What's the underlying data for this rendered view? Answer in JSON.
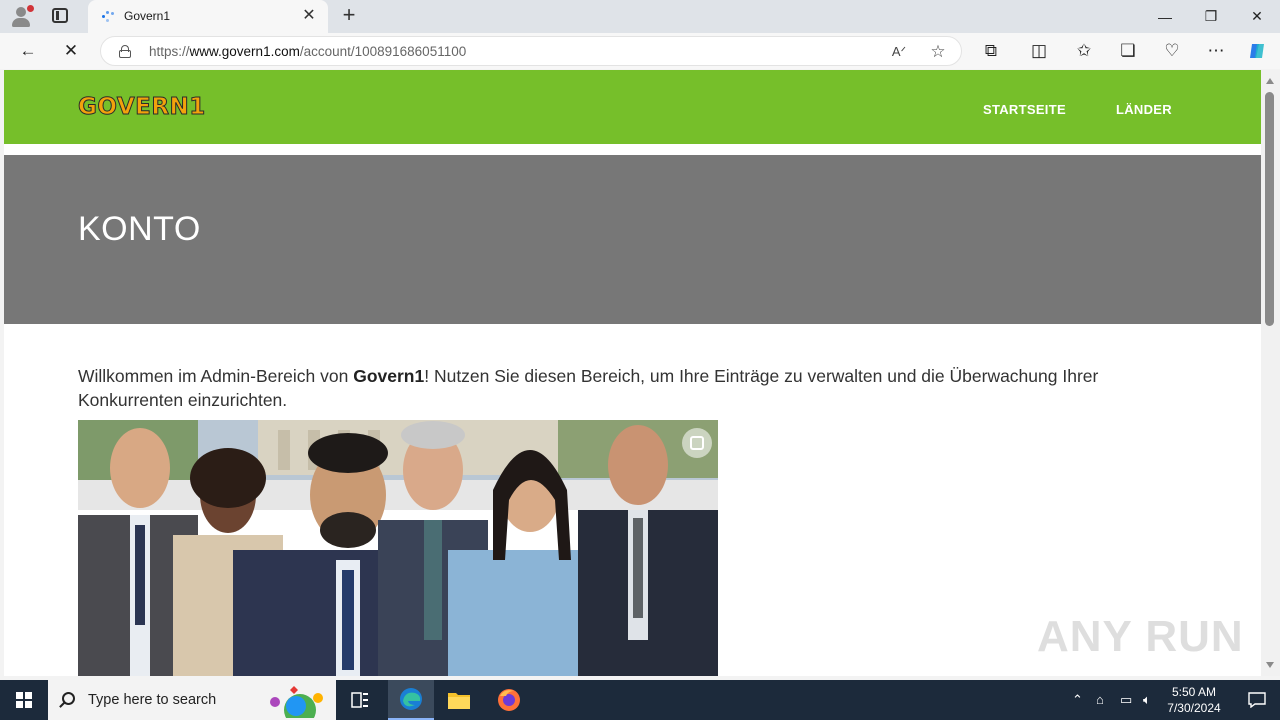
{
  "browser": {
    "tab_title": "Govern1",
    "url_prefix": "https://",
    "url_host": "www.govern1.com",
    "url_path": "/account/100891686051100",
    "icons": [
      "profile-icon",
      "tabs-icon",
      "close-icon",
      "plus-icon",
      "minimize-icon",
      "restore-icon",
      "back-icon",
      "stop-icon",
      "lock-icon",
      "read-aloud-icon",
      "favorite-star-icon",
      "extensions-icon",
      "split-screen-icon",
      "favorites-icon",
      "collections-icon",
      "browser-essentials-icon",
      "more-icon",
      "copilot-icon"
    ]
  },
  "site": {
    "logo": "GOVERN1",
    "nav": [
      "STARTSEITE",
      "LÄNDER"
    ],
    "hero_title": "KONTO",
    "intro_before": "Willkommen im Admin-Bereich von ",
    "intro_brand": "Govern1",
    "intro_after": "! Nutzen Sie diesen Bereich, um Ihre Einträge zu verwalten und die Überwachung Ihrer Konkurrenten einzurichten.",
    "accent_color": "#76bf2a",
    "hero_color": "#777777"
  },
  "watermark": "ANY RUN",
  "taskbar": {
    "search_placeholder": "Type here to search",
    "time": "5:50 AM",
    "date": "7/30/2024"
  }
}
